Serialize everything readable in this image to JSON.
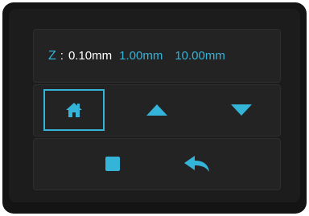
{
  "z_axis": {
    "label": "Z",
    "colon": ":",
    "step_options": [
      "0.10mm",
      "1.00mm",
      "10.00mm"
    ],
    "selected_step": "0.10mm"
  },
  "controls": {
    "home_icon": "home-icon",
    "up_icon": "triangle-up-icon",
    "down_icon": "triangle-down-icon",
    "stop_icon": "stop-square-icon",
    "back_icon": "back-arrow-icon"
  },
  "colors": {
    "accent": "#35b4da",
    "text": "#ffffff",
    "panel": "#232323",
    "background": "#1c1c1c"
  }
}
